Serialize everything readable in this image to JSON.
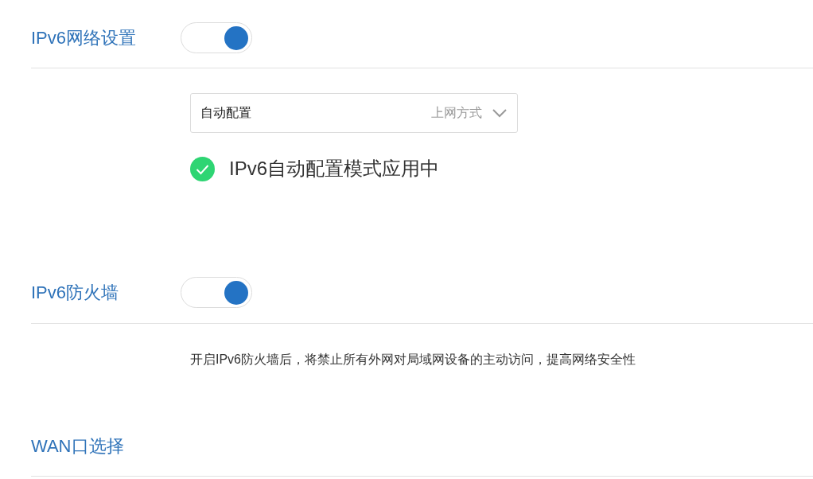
{
  "ipv6": {
    "label": "IPv6网络设置",
    "on": true,
    "dropdown": {
      "value": "自动配置",
      "hint": "上网方式"
    },
    "status": {
      "ok": true,
      "text": "IPv6自动配置模式应用中"
    }
  },
  "firewall": {
    "label": "IPv6防火墙",
    "on": true,
    "description": "开启IPv6防火墙后，将禁止所有外网对局域网设备的主动访问，提高网络安全性"
  },
  "wan": {
    "label": "WAN口选择"
  }
}
